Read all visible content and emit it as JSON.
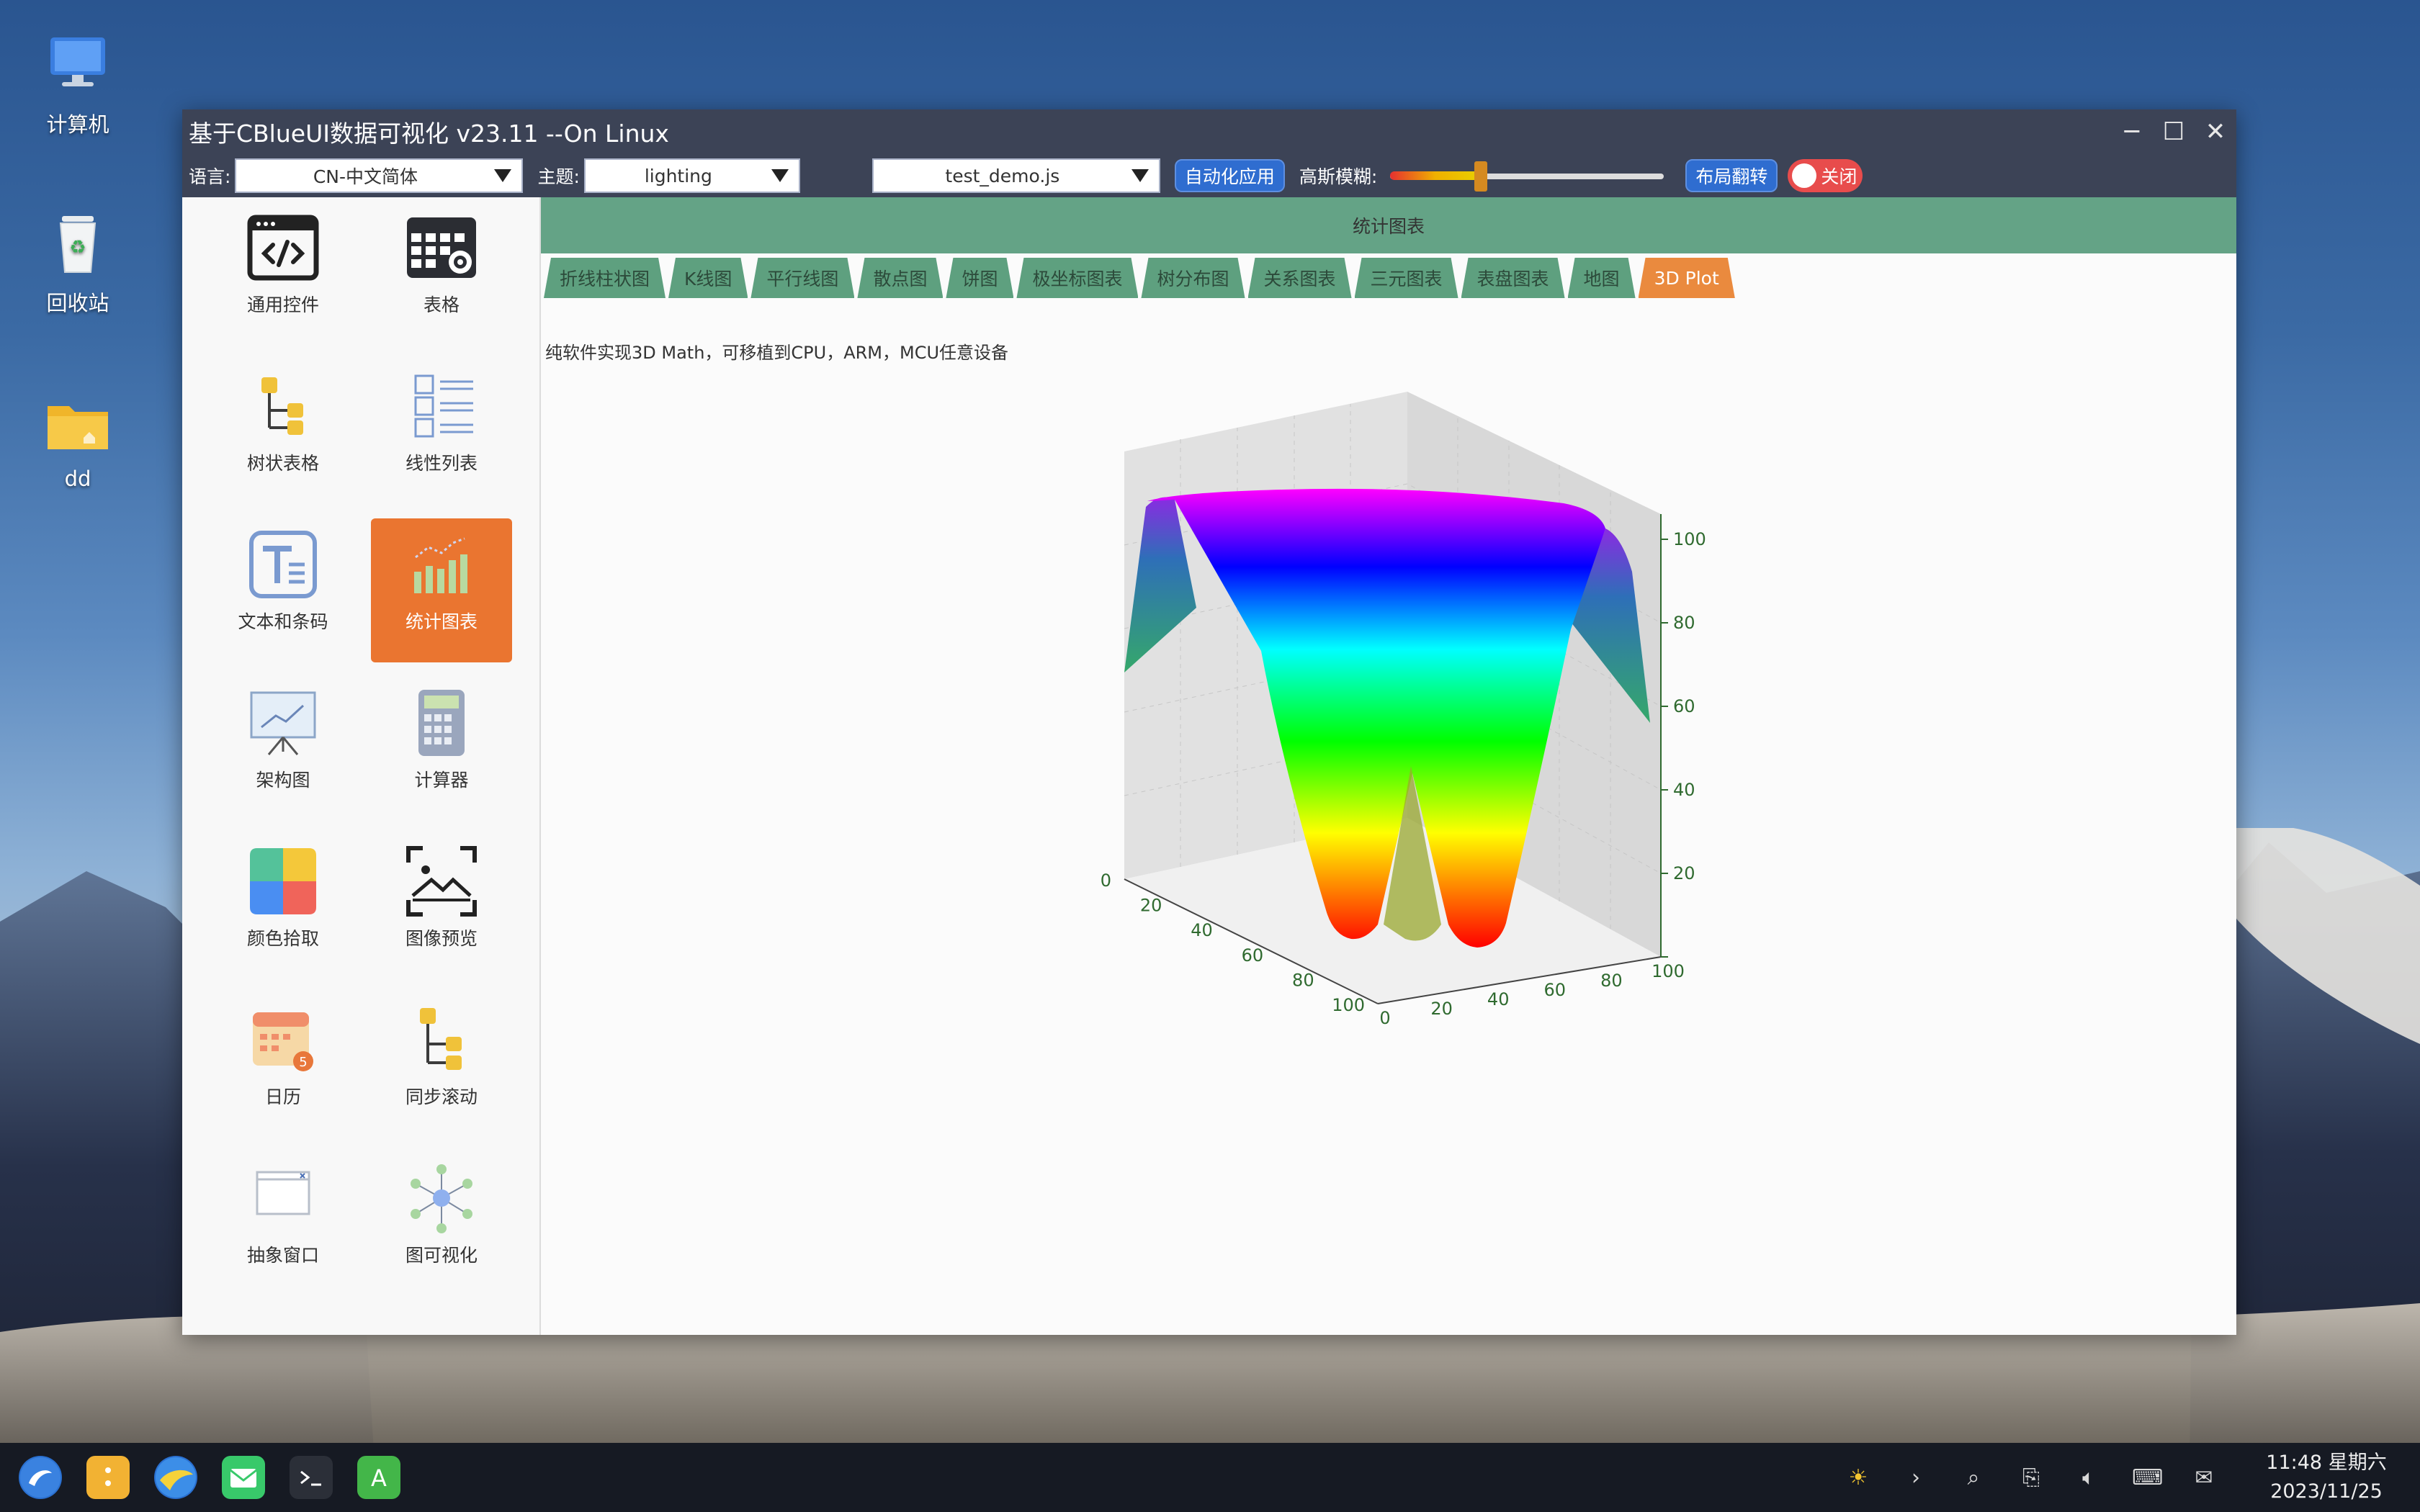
{
  "desktop": {
    "icons": [
      {
        "label": "计算机",
        "icon": "computer-icon"
      },
      {
        "label": "回收站",
        "icon": "trash-icon"
      },
      {
        "label": "dd",
        "icon": "folder-icon"
      }
    ]
  },
  "window": {
    "title": "基于CBlueUI数据可视化 v23.11 --On Linux"
  },
  "toolbar": {
    "lang_label": "语言:",
    "lang_value": "CN-中文简体",
    "theme_label": "主题:",
    "theme_value": "lighting",
    "script_value": "test_demo.js",
    "auto_apply_label": "自动化应用",
    "blur_label": "高斯模糊:",
    "blur_level": 0.33,
    "layout_flip_label": "布局翻转",
    "toggle_label": "关闭"
  },
  "sidebar": {
    "items": [
      {
        "label": "通用控件",
        "icon": "code-window-icon"
      },
      {
        "label": "表格",
        "icon": "table-settings-icon"
      },
      {
        "label": "树状表格",
        "icon": "tree-table-icon"
      },
      {
        "label": "线性列表",
        "icon": "list-icon"
      },
      {
        "label": "文本和条码",
        "icon": "text-icon"
      },
      {
        "label": "统计图表",
        "icon": "bar-chart-icon",
        "active": true
      },
      {
        "label": "架构图",
        "icon": "presentation-icon"
      },
      {
        "label": "计算器",
        "icon": "calculator-icon"
      },
      {
        "label": "颜色拾取",
        "icon": "color-palette-icon"
      },
      {
        "label": "图像预览",
        "icon": "image-preview-icon"
      },
      {
        "label": "日历",
        "icon": "calendar-icon"
      },
      {
        "label": "同步滚动",
        "icon": "sync-scroll-icon"
      },
      {
        "label": "抽象窗口",
        "icon": "abstract-window-icon"
      },
      {
        "label": "图可视化",
        "icon": "graph-network-icon"
      }
    ]
  },
  "content": {
    "header": "统计图表",
    "tabs": [
      "折线柱状图",
      "K线图",
      "平行线图",
      "散点图",
      "饼图",
      "极坐标图表",
      "树分布图",
      "关系图表",
      "三元图表",
      "表盘图表",
      "地图",
      "3D Plot"
    ],
    "active_tab": "3D Plot",
    "description": "纯软件实现3D Math，可移植到CPU，ARM，MCU任意设备"
  },
  "chart_data": {
    "type": "surface3d",
    "x_ticks": [
      "0",
      "20",
      "40",
      "60",
      "80",
      "100"
    ],
    "y_ticks": [
      "0",
      "20",
      "40",
      "60",
      "80",
      "100"
    ],
    "z_ticks": [
      "20",
      "40",
      "60",
      "80",
      "100"
    ],
    "xlim": [
      0,
      100
    ],
    "ylim": [
      0,
      100
    ],
    "zlim": [
      0,
      100
    ],
    "colormap": [
      "#ff0000",
      "#ffff00",
      "#00ff00",
      "#00ffff",
      "#0000ff",
      "#ff00ff"
    ]
  },
  "taskbar": {
    "time": "11:48 星期六",
    "date": "2023/11/25"
  }
}
